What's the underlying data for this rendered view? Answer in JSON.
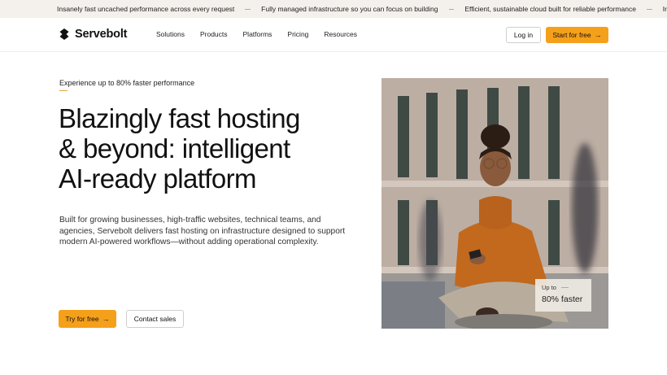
{
  "ticker": {
    "items": [
      "Insanely fast uncached performance across every request",
      "Fully managed infrastructure so you can focus on building",
      "Efficient, sustainable cloud built for reliable performance",
      "Ir"
    ]
  },
  "nav": {
    "brand": "Servebolt",
    "menu": [
      "Solutions",
      "Products",
      "Platforms",
      "Pricing",
      "Resources"
    ],
    "login_label": "Log in",
    "start_label": "Start for free",
    "start_arrow": "→"
  },
  "hero": {
    "eyebrow": "Experience up to 80% faster performance",
    "headline_lines": [
      "Blazingly fast hosting",
      "& beyond: intelligent",
      "AI-ready platform"
    ],
    "subtext": "Built for growing businesses, high-traffic websites, technical teams, and agencies, Servebolt delivers fast hosting on infrastructure designed to support modern AI-powered workflows—without adding operational complexity.",
    "try_label": "Try for free",
    "try_arrow": "→",
    "sales_label": "Contact sales"
  },
  "badge": {
    "small": "Up to",
    "big": "80% faster"
  },
  "colors": {
    "accent": "#f5a01a",
    "ticker_bg": "#f4f1ec"
  }
}
